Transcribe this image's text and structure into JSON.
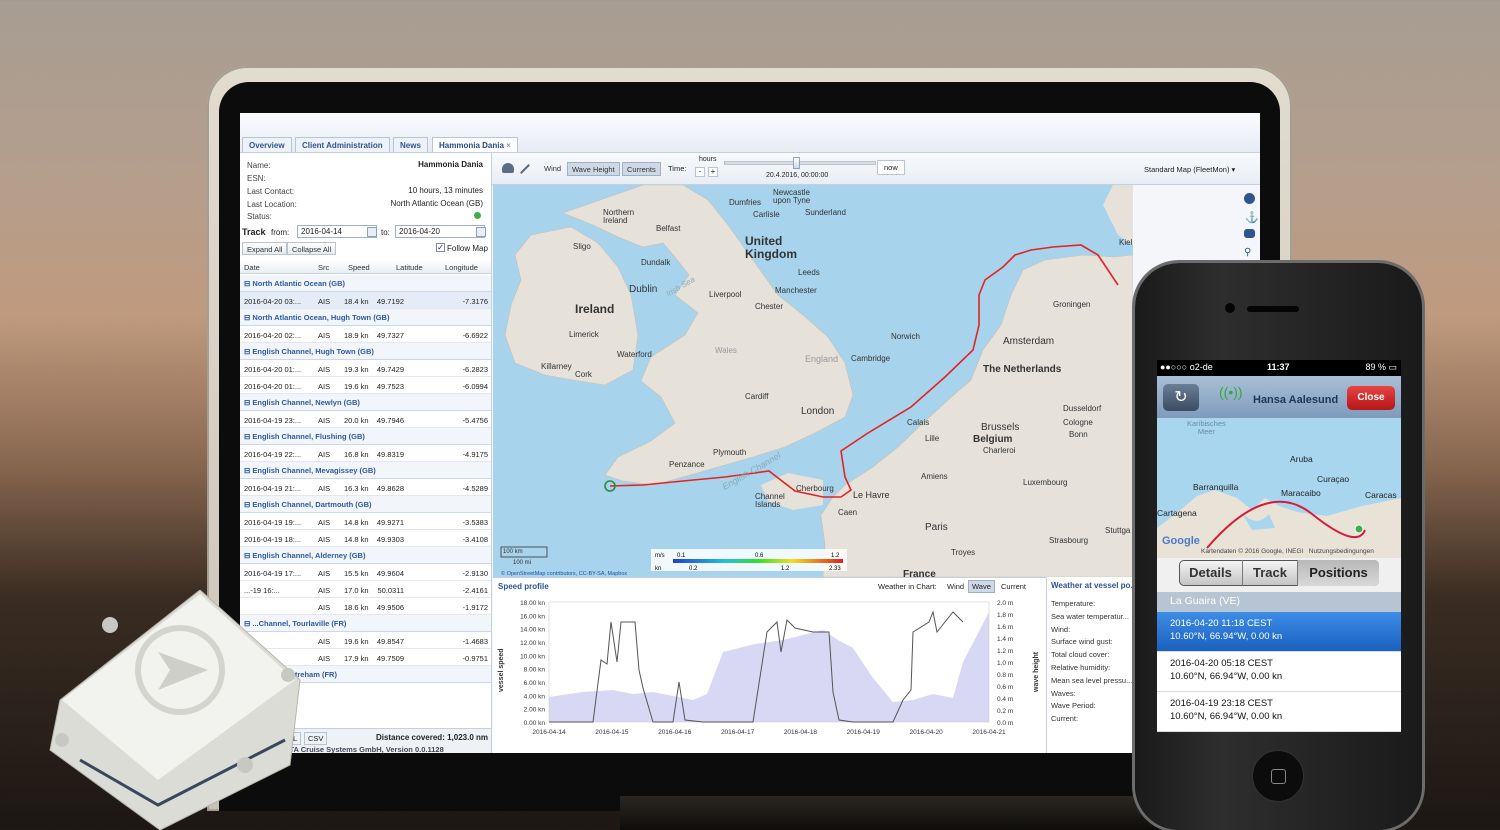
{
  "tabs": [
    "Overview",
    "Client Administration",
    "News",
    "Hammonia Dania"
  ],
  "close_x": "×",
  "vessel": {
    "name_label": "Name:",
    "name_value": "Hammonia Dania",
    "esn_label": "ESN:",
    "contact_label": "Last Contact:",
    "contact_value": "10 hours, 13 minutes",
    "location_label": "Last Location:",
    "location_value": "North Atlantic Ocean (GB)",
    "status_label": "Status:"
  },
  "track": {
    "label": "Track",
    "from_label": "from:",
    "from_value": "2016-04-14",
    "to_label": "to:",
    "to_value": "2016-04-20",
    "expand_all": "Expand All",
    "collapse_all": "Collapse All",
    "follow_map": "Follow Map"
  },
  "columns": [
    "Date",
    "Src",
    "Speed",
    "Latitude",
    "Longitude"
  ],
  "groups": [
    {
      "title": "North Atlantic Ocean (GB)",
      "rows": [
        [
          "2016-04-20 03:...",
          "AIS",
          "18.4 kn",
          "49.7192",
          "-7.3176"
        ]
      ]
    },
    {
      "title": "North Atlantic Ocean, Hugh Town (GB)",
      "rows": [
        [
          "2016-04-20 02:...",
          "AIS",
          "18.9 kn",
          "49.7327",
          "-6.6922"
        ]
      ]
    },
    {
      "title": "English Channel, Hugh Town (GB)",
      "rows": [
        [
          "2016-04-20 01:...",
          "AIS",
          "19.3 kn",
          "49.7429",
          "-6.2823"
        ],
        [
          "2016-04-20 01:...",
          "AIS",
          "19.6 kn",
          "49.7523",
          "-6.0994"
        ]
      ]
    },
    {
      "title": "English Channel, Newlyn (GB)",
      "rows": [
        [
          "2016-04-19 23:...",
          "AIS",
          "20.0 kn",
          "49.7946",
          "-5.4756"
        ]
      ]
    },
    {
      "title": "English Channel, Flushing (GB)",
      "rows": [
        [
          "2016-04-19 22:...",
          "AIS",
          "16.8 kn",
          "49.8319",
          "-4.9175"
        ]
      ]
    },
    {
      "title": "English Channel, Mevagissey (GB)",
      "rows": [
        [
          "2016-04-19 21:...",
          "AIS",
          "16.3 kn",
          "49.8628",
          "-4.5289"
        ]
      ]
    },
    {
      "title": "English Channel, Dartmouth (GB)",
      "rows": [
        [
          "2016-04-19 19:...",
          "AIS",
          "14.8 kn",
          "49.9271",
          "-3.5383"
        ],
        [
          "2016-04-19 18:...",
          "AIS",
          "14.8 kn",
          "49.9303",
          "-3.4108"
        ]
      ]
    },
    {
      "title": "English Channel, Alderney (GB)",
      "rows": [
        [
          "2016-04-19 17:...",
          "AIS",
          "15.5 kn",
          "49.9604",
          "-2.9130"
        ],
        [
          "...-19 16:...",
          "AIS",
          "17.0 kn",
          "50.0311",
          "-2.4161"
        ],
        [
          "",
          "AIS",
          "18.6 kn",
          "49.9506",
          "-1.9172"
        ]
      ]
    },
    {
      "title": "...Channel, Tourlaville (FR)",
      "rows": [
        [
          "",
          "AIS",
          "19.6 kn",
          "49.8547",
          "-1.4683"
        ],
        [
          "",
          "AIS",
          "17.9 kn",
          "49.7509",
          "-0.9751"
        ]
      ]
    },
    {
      "title": "...nnel, Quistreham (FR)",
      "rows": []
    }
  ],
  "bottom": {
    "csv": "CSV",
    "xl": "XL",
    "distance": "Distance covered: 1,023.0 nm",
    "copyright": "...KOTA Cruise Systems GmbH, Version 0.0.1128"
  },
  "toolbar": {
    "wind": "Wind",
    "wave": "Wave Height",
    "currents": "Currents",
    "time": "Time:",
    "hours": "hours",
    "minus": "-",
    "plus": "+",
    "date": "20.4.2016, 00:00:00",
    "now": "now",
    "maptype": "Standard Map (FleetMon)"
  },
  "map_labels": {
    "ireland": "Ireland",
    "northern_ireland": "Northern\nIreland",
    "uk": "United\nKingdom",
    "england": "England",
    "wales": "Wales",
    "london": "London",
    "dublin": "Dublin",
    "belfast": "Belfast",
    "sligo": "Sligo",
    "dundalk": "Dundalk",
    "limerick": "Limerick",
    "waterford": "Waterford",
    "cork": "Cork",
    "killarney": "Killarney",
    "liverpool": "Liverpool",
    "manchester": "Manchester",
    "leeds": "Leeds",
    "chester": "Chester",
    "newcastle": "Newcastle\nupon Tyne",
    "dumfries": "Dumfries",
    "carlisle": "Carlisle",
    "sunderland": "Sunderland",
    "norwich": "Norwich",
    "cambridge": "Cambridge",
    "cardiff": "Cardiff",
    "plymouth": "Plymouth",
    "penzance": "Penzance",
    "calais": "Calais",
    "lille": "Lille",
    "amiens": "Amiens",
    "paris": "Paris",
    "caen": "Caen",
    "le_havre": "Le Havre",
    "cherbourg": "Cherbourg",
    "channel_islands": "Channel\nIslands",
    "amsterdam": "Amsterdam",
    "netherlands": "The Netherlands",
    "belgium": "Belgium",
    "brussels": "Brussels",
    "groningen": "Groningen",
    "dusseldorf": "Dusseldorf",
    "cologne": "Cologne",
    "bonn": "Bonn",
    "charleroi": "Charleroi",
    "luxembourg": "Luxembourg",
    "strasbourg": "Strasbourg",
    "troyes": "Troyes",
    "stuttgart": "Stuttga",
    "kiel": "Kiel",
    "irish_sea": "Irish Sea",
    "english_channel": "English Channel",
    "karibisches": "Karibisches\nMeer",
    "france": "France"
  },
  "scale": {
    "top": "100 km",
    "bottom": "100 mi"
  },
  "legend": {
    "unit_top": "m/s",
    "unit_bottom": "kn",
    "v1": "0.1",
    "v2": "0.6",
    "v3": "1.2",
    "v4": "0.2",
    "v5": "1.2",
    "v6": "2.33"
  },
  "attribution": "© OpenStreetMap contributors, CC-BY-SA, Mapbox",
  "speed_profile": {
    "title": "Speed profile",
    "weather_in_chart": "Weather in Chart:",
    "wind": "Wind",
    "wave": "Wave",
    "current": "Current",
    "ylabel": "vessel speed",
    "y2label": "wave height",
    "yticks": [
      "18.00 kn",
      "16.00 kn",
      "14.00 kn",
      "12.00 kn",
      "10.00 kn",
      "8.00 kn",
      "6.00 kn",
      "4.00 kn",
      "2.00 kn",
      "0.00 kn"
    ],
    "y2ticks": [
      "2.0 m",
      "1.8 m",
      "1.6 m",
      "1.4 m",
      "1.2 m",
      "1.0 m",
      "0.8 m",
      "0.6 m",
      "0.4 m",
      "0.2 m",
      "0.0 m"
    ],
    "xticks": [
      "2016-04-14",
      "2016-04-15",
      "2016-04-16",
      "2016-04-17",
      "2016-04-18",
      "2016-04-19",
      "2016-04-20",
      "2016-04-21"
    ]
  },
  "weather": {
    "title": "Weather at vessel po...",
    "fields": [
      "Temperature:",
      "Sea water temperatur...",
      "Wind:",
      "Surface wind gust:",
      "Total cloud cover:",
      "Relative humidity:",
      "Mean sea level pressu...",
      "Waves:",
      "Wave Period:",
      "Current:"
    ]
  },
  "phone": {
    "carrier": "o2-de",
    "time": "11:37",
    "battery": "89 %",
    "vessel": "Hansa Aalesund",
    "close": "Close",
    "map_labels": {
      "aruba": "Aruba",
      "curacao": "Curaçao",
      "barranquilla": "Barranquilla",
      "maracaibo": "Maracaibo",
      "caracas": "Caracas",
      "cartagena": "Cartagena"
    },
    "google": "Google",
    "attribution": "Kartendaten © 2016 Google, INEGI   Nutzungsbedingungen",
    "tabs": [
      "Details",
      "Track",
      "Positions"
    ],
    "section": "La Guaira (VE)",
    "positions": [
      {
        "time": "2016-04-20 11:18 CEST",
        "pos": "10.60°N, 66.94°W, 0.00 kn"
      },
      {
        "time": "2016-04-20 05:18 CEST",
        "pos": "10.60°N, 66.94°W, 0.00 kn"
      },
      {
        "time": "2016-04-19 23:18 CEST",
        "pos": "10.60°N, 66.94°W, 0.00 kn"
      }
    ]
  },
  "colors": {
    "accent": "#2e5590",
    "route": "#e52220",
    "phone_blue": "#1a72c8",
    "close_red": "#d21f1f"
  }
}
